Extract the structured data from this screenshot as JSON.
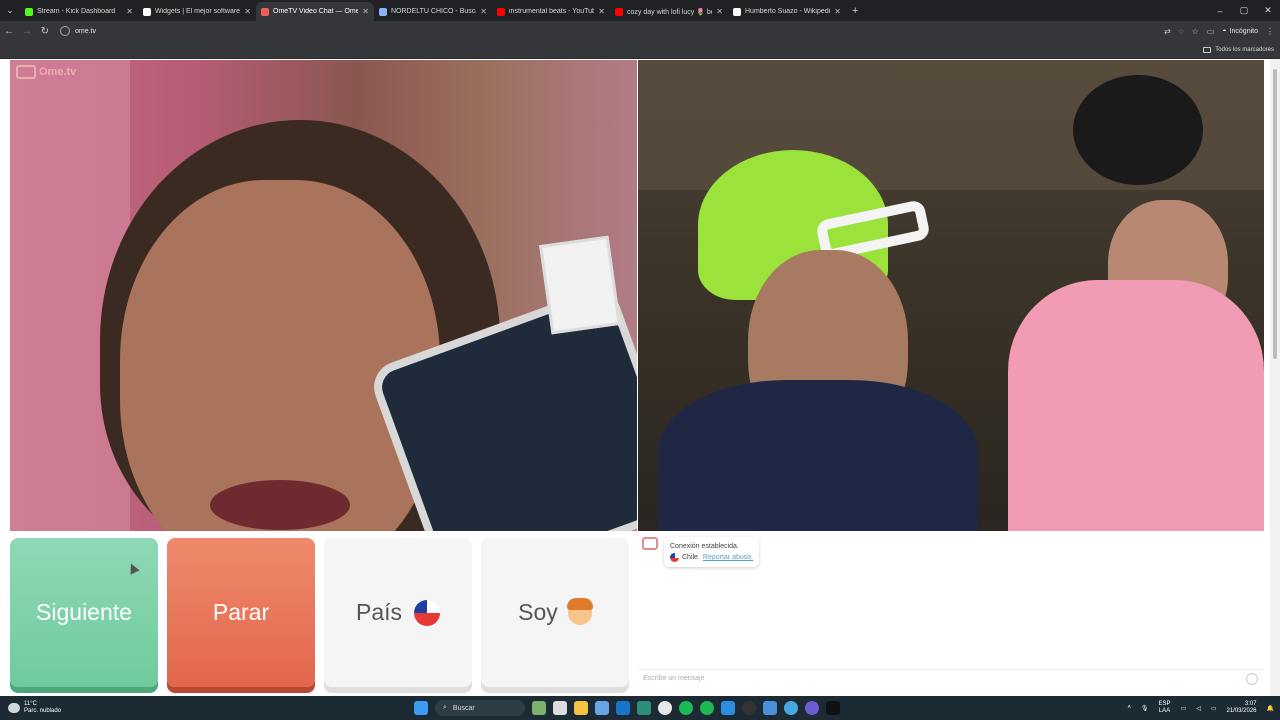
{
  "browser": {
    "tabs": [
      {
        "title": "Stream - Kick Dashboard",
        "color": "#53fc18",
        "active": false
      },
      {
        "title": "Widgets | El mejor software pa",
        "color": "#ffffff",
        "active": false
      },
      {
        "title": "OmeTV Video Chat — Ome",
        "color": "#f15a5a",
        "active": true
      },
      {
        "title": "NORDELTU CHICO - Buscar co",
        "color": "#8ab4f8",
        "active": false
      },
      {
        "title": "instrumental beats - YouTube",
        "color": "#ff0000",
        "active": false
      },
      {
        "title": "cozy day with lofi lucy 🌷 beats",
        "color": "#ff0000",
        "active": false
      },
      {
        "title": "Humberto Suazo - Wikipedia, l",
        "color": "#ffffff",
        "active": false
      }
    ],
    "url": "ome.tv",
    "incognito_label": "Incógnito",
    "bookmarks_label": "Todos los marcadores"
  },
  "page": {
    "brand": "Ome.tv",
    "buttons": {
      "next": "Siguiente",
      "stop": "Parar",
      "country": "País",
      "gender": "Soy"
    },
    "chat": {
      "status": "Conexión establecida.",
      "country": "Chile.",
      "report": "Reportar abuso.",
      "input_placeholder": "Escribe un mensaje"
    }
  },
  "taskbar": {
    "temperature": "11°C",
    "weather": "Parc. nublado",
    "search_label": "Buscar",
    "lang_top": "ESP",
    "lang_bottom": "LAA",
    "time": "3:07",
    "date": "21/03/2026"
  }
}
